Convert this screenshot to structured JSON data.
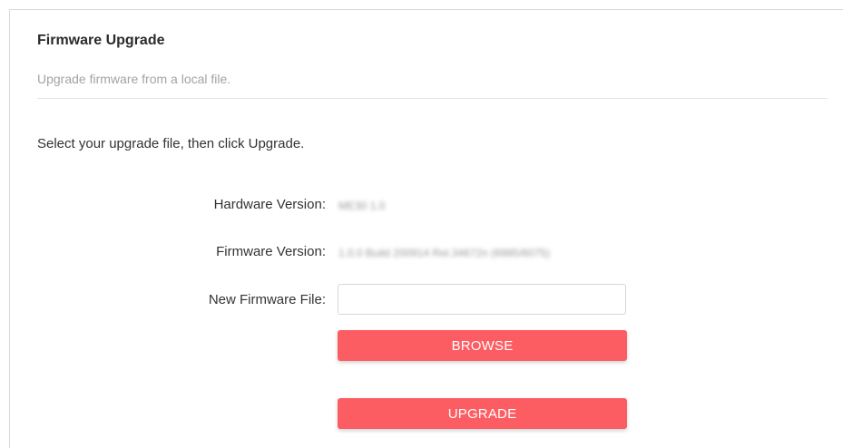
{
  "section": {
    "title": "Firmware Upgrade",
    "subtitle": "Upgrade firmware from a local file.",
    "instruction": "Select your upgrade file, then click Upgrade."
  },
  "fields": {
    "hardware_version": {
      "label": "Hardware Version:",
      "value": "ME30 1.0"
    },
    "firmware_version": {
      "label": "Firmware Version:",
      "value": "1.0.0 Build 200914 Rel.34672n (6985/6075)"
    },
    "new_firmware_file": {
      "label": "New Firmware File:",
      "value": ""
    }
  },
  "buttons": {
    "browse": "BROWSE",
    "upgrade": "UPGRADE"
  },
  "colors": {
    "accent": "#fc5d62",
    "title_text": "#2b2b2b",
    "muted_text": "#a3a3a3"
  }
}
